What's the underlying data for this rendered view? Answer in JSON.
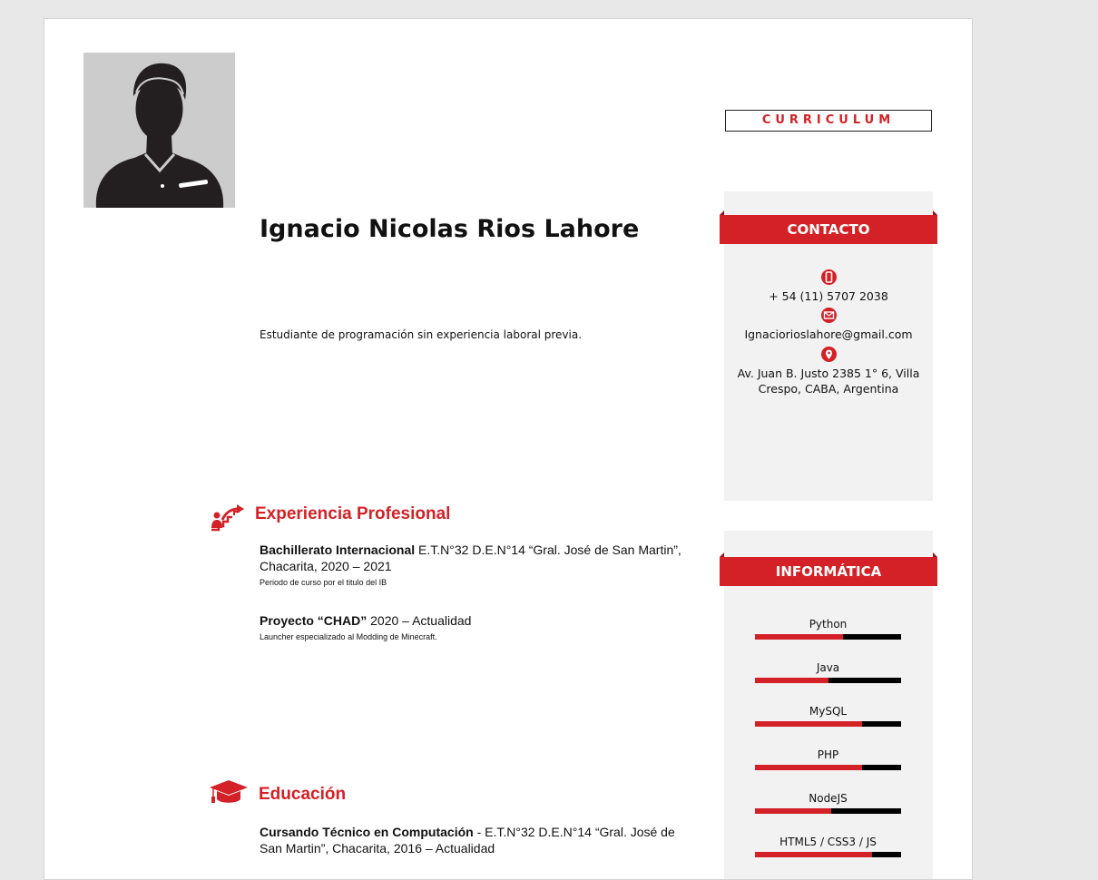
{
  "header": {
    "cv_title": "CURRICULUM",
    "name": "Ignacio Nicolas Rios Lahore",
    "summary": "Estudiante de programación sin experiencia laboral previa."
  },
  "contact": {
    "title": "CONTACTO",
    "phone": "+ 54 (11) 5707 2038",
    "email": "Ignaciorioslahore@gmail.com",
    "address": "Av. Juan B. Justo 2385 1° 6, Villa Crespo, CABA, Argentina"
  },
  "experience": {
    "title": "Experiencia Profesional",
    "entries": [
      {
        "title": "Bachillerato Internacional",
        "detail": " E.T.N°32 D.E.N°14 “Gral. José de San Martin”, Chacarita, 2020 – 2021",
        "sub": "Periodo de curso por el titulo del IB"
      },
      {
        "title": "Proyecto “CHAD”",
        "detail": " 2020 – Actualidad",
        "sub": "Launcher especializado al Modding de Minecraft."
      }
    ]
  },
  "education": {
    "title": "Educación",
    "entries": [
      {
        "title": "Cursando Técnico en Computación",
        "detail": " - E.T.N°32 D.E.N°14 “Gral. José de San Martin”, Chacarita, 2016 – Actualidad"
      }
    ]
  },
  "skills": {
    "title": "INFORMÁTICA",
    "items": [
      {
        "name": "Python",
        "level": 0.6
      },
      {
        "name": "Java",
        "level": 0.5
      },
      {
        "name": "MySQL",
        "level": 0.73
      },
      {
        "name": "PHP",
        "level": 0.73
      },
      {
        "name": "NodeJS",
        "level": 0.52
      },
      {
        "name": "HTML5 / CSS3 / JS",
        "level": 0.8
      }
    ]
  },
  "colors": {
    "accent": "#d42127",
    "panel": "#f2f2f2"
  }
}
